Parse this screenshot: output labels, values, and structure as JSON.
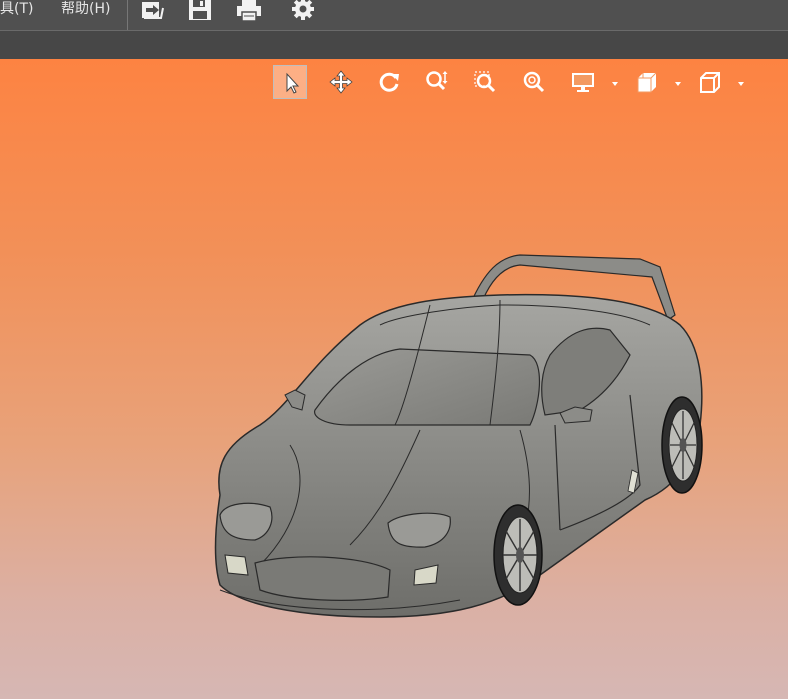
{
  "menu": {
    "tools_label": "具(T)",
    "help_label": "帮助(H)"
  },
  "toolbar": {
    "icons": [
      "reload-icon",
      "save-icon",
      "print-icon",
      "settings-icon"
    ]
  },
  "view_toolbar": {
    "tools": [
      "select-icon",
      "pan-icon",
      "rotate-icon",
      "zoom-icon",
      "zoom-window-icon",
      "zoom-fit-icon",
      "display-mode-icon",
      "shading-icon",
      "view-cube-icon"
    ],
    "active_tool": "select-icon"
  },
  "colors": {
    "menubar": "#505050",
    "background_top": "#fd8342",
    "background_bottom": "#d6b7b4",
    "model_fill": "#8c8c88"
  },
  "model": {
    "icon": "sports-car-3d-model"
  }
}
